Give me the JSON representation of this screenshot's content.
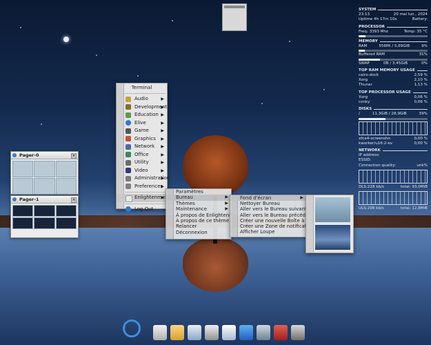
{
  "desktop": {},
  "conky": {
    "system": {
      "title": "SYSTEM",
      "time": "23:13",
      "date": "20 mai lun., 2024",
      "uptime": "Uptime 4h 17m 10s",
      "battery": "Battery:"
    },
    "processor": {
      "title": "PROCESSOR",
      "freq": "Freq: 3393 Mhz",
      "temp": "Temp: 35 °C",
      "bar_pct": 10
    },
    "memory": {
      "title": "MEMORY",
      "ram_label": "RAM",
      "ram_value": "556Mi / 5,69GiB",
      "ram_pct": "9%",
      "buffered_label": "Buffered RAM",
      "buffered_pct": "31%",
      "swap_label": "SWAP",
      "swap_value": "0B / 3,45GiB",
      "swap_pct": "0%"
    },
    "top_ram": {
      "title": "TOP RAM MEMORY USAGE",
      "rows": [
        {
          "name": "cairo-dock",
          "value": "2,59 %"
        },
        {
          "name": "Xorg",
          "value": "2,10 %"
        },
        {
          "name": "Thunar",
          "value": "1,13 %"
        }
      ]
    },
    "top_proc": {
      "title": "TOP PROCESSOR USAGE",
      "rows": [
        {
          "name": "Xorg",
          "value": "0,06 %"
        },
        {
          "name": "conky",
          "value": "0,06 %"
        }
      ]
    },
    "disks": {
      "title": "DISKS",
      "mount": "/",
      "value": "11,3GiB / 28,9GiB",
      "pct": "39%",
      "rows": [
        {
          "name": "xfce4-screensho",
          "value": "0,00 %"
        },
        {
          "name": "kworker/u16:2-ev",
          "value": "0,00 %"
        }
      ]
    },
    "network": {
      "title": "NETWORK",
      "ip": "IP address:",
      "essid": "ESSID:",
      "quality": "Connection quality:",
      "quality_value": "unk%",
      "dls": "DLS:228 kb/s",
      "dls_total": "total: 93,0MiB",
      "uls": "ULS:208 kb/s",
      "uls_total": "total: 12,8MiB"
    }
  },
  "pager0": {
    "title": "Pager-0"
  },
  "pager1": {
    "title": "Pager-1"
  },
  "main_menu": {
    "title": "Terminal",
    "items": [
      {
        "label": "Audio",
        "icon": "audio-icon",
        "color": "#c8a040"
      },
      {
        "label": "Development",
        "icon": "development-icon",
        "color": "#8a6a30"
      },
      {
        "label": "Education",
        "icon": "education-icon",
        "color": "#5a9a4a"
      },
      {
        "label": "Elive",
        "icon": "elive-icon",
        "color": "#2f7ad0"
      },
      {
        "label": "Game",
        "icon": "game-icon",
        "color": "#555555"
      },
      {
        "label": "Graphics",
        "icon": "graphics-icon",
        "color": "#c0543a"
      },
      {
        "label": "Network",
        "icon": "network-icon",
        "color": "#4a6aa0"
      },
      {
        "label": "Office",
        "icon": "office-icon",
        "color": "#3a8a5a"
      },
      {
        "label": "Utility",
        "icon": "utility-icon",
        "color": "#6a6a6a"
      },
      {
        "label": "Video",
        "icon": "video-icon",
        "color": "#303a80"
      },
      {
        "label": "Administration",
        "icon": "administration-icon",
        "color": "#7a7a7a"
      },
      {
        "label": "Preferences",
        "icon": "preferences-icon",
        "color": "#808080"
      }
    ],
    "enlightenment": "Enlightenment",
    "logout": "Log Out"
  },
  "enl_menu": {
    "items": [
      "Paramètres",
      "Bureau",
      "Thèmes",
      "Maintenance",
      "À propos de Enlightenment",
      "À propos de ce thème",
      "Relancer",
      "Déconnexion"
    ]
  },
  "bureau_menu": {
    "items": [
      "Fond d'écran",
      "Nettoyer Bureau",
      "Aller vers le Bureau suivant",
      "Aller vers le Bureau précédent",
      "Créer une nouvelle Boîte à icônes",
      "Créer une Zone de notification",
      "Afficher Loupe"
    ]
  },
  "dock": {
    "items": [
      "home-icon",
      "folder-icon",
      "text-editor-icon",
      "volume-icon",
      "files-icon",
      "wifi-icon",
      "monitor-icon",
      "logout-icon",
      "trash-icon"
    ]
  }
}
